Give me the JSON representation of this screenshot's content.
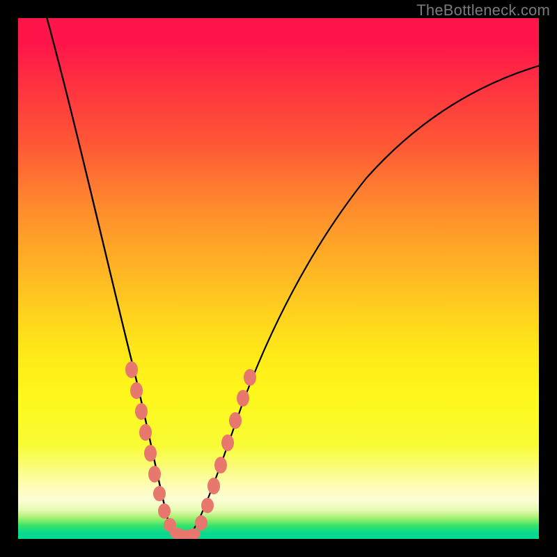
{
  "watermark": "TheBottleneck.com",
  "chart_data": {
    "type": "line",
    "title": "",
    "xlabel": "",
    "ylabel": "",
    "xlim": [
      0,
      100
    ],
    "ylim": [
      0,
      100
    ],
    "background_gradient": {
      "top": "#ff1649",
      "mid": "#ffe819",
      "bottom": "#03d992"
    },
    "series": [
      {
        "name": "left-branch",
        "approx_points": [
          {
            "x": 5,
            "y": 100
          },
          {
            "x": 12,
            "y": 72
          },
          {
            "x": 18,
            "y": 46
          },
          {
            "x": 22,
            "y": 26
          },
          {
            "x": 25,
            "y": 12
          },
          {
            "x": 27,
            "y": 4
          },
          {
            "x": 29,
            "y": 0.5
          }
        ]
      },
      {
        "name": "right-branch",
        "approx_points": [
          {
            "x": 32,
            "y": 0.5
          },
          {
            "x": 36,
            "y": 8
          },
          {
            "x": 42,
            "y": 22
          },
          {
            "x": 50,
            "y": 40
          },
          {
            "x": 60,
            "y": 56
          },
          {
            "x": 72,
            "y": 70
          },
          {
            "x": 85,
            "y": 80
          },
          {
            "x": 100,
            "y": 87
          }
        ]
      }
    ],
    "scatter": {
      "name": "markers",
      "color": "#e8786d",
      "points": [
        {
          "x": 21.5,
          "y": 32
        },
        {
          "x": 22.5,
          "y": 28
        },
        {
          "x": 23.5,
          "y": 24
        },
        {
          "x": 24.0,
          "y": 20
        },
        {
          "x": 25.0,
          "y": 16
        },
        {
          "x": 25.8,
          "y": 12
        },
        {
          "x": 26.5,
          "y": 9
        },
        {
          "x": 27.0,
          "y": 6
        },
        {
          "x": 28.0,
          "y": 3
        },
        {
          "x": 29.0,
          "y": 1
        },
        {
          "x": 30.0,
          "y": 0.5
        },
        {
          "x": 31.0,
          "y": 0.5
        },
        {
          "x": 32.0,
          "y": 1
        },
        {
          "x": 33.0,
          "y": 2
        },
        {
          "x": 34.0,
          "y": 4
        },
        {
          "x": 35.5,
          "y": 8
        },
        {
          "x": 37.0,
          "y": 13
        },
        {
          "x": 38.5,
          "y": 17
        },
        {
          "x": 40.0,
          "y": 22
        },
        {
          "x": 41.5,
          "y": 27
        },
        {
          "x": 43.0,
          "y": 32
        }
      ]
    }
  }
}
